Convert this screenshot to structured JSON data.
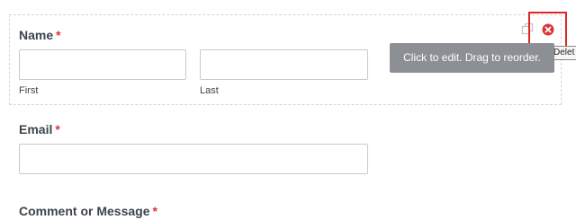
{
  "form": {
    "name_field": {
      "label": "Name",
      "required_mark": "*",
      "first": {
        "sublabel": "First",
        "value": ""
      },
      "last": {
        "sublabel": "Last",
        "value": ""
      }
    },
    "email_field": {
      "label": "Email",
      "required_mark": "*",
      "value": ""
    },
    "comment_field": {
      "label": "Comment or Message",
      "required_mark": "*"
    }
  },
  "field_actions": {
    "duplicate_icon": "duplicate-icon",
    "delete_icon": "delete-icon",
    "delete_tooltip": "Delet"
  },
  "edit_tooltip": "Click to edit. Drag to reorder.",
  "colors": {
    "required": "#d63638",
    "delete": "#d63638",
    "highlight": "#e02424",
    "tooltip_bg": "#8c8f94"
  }
}
